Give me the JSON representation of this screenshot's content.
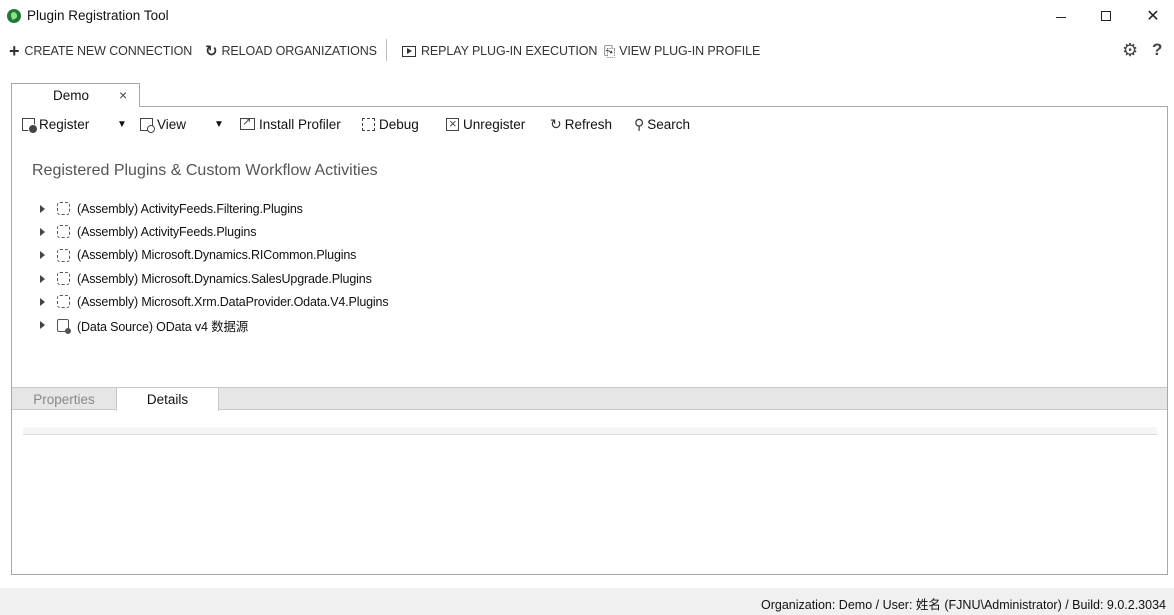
{
  "window": {
    "title": "Plugin Registration Tool",
    "minimize_icon": "minimize-icon",
    "maximize_icon": "maximize-icon",
    "close_glyph": "✕"
  },
  "main_toolbar": {
    "create_connection": "CREATE NEW CONNECTION",
    "reload_organizations": "RELOAD ORGANIZATIONS",
    "replay_execution": "REPLAY PLUG-IN EXECUTION",
    "view_profile": "VIEW PLUG-IN PROFILE",
    "settings_icon": "gear-icon",
    "help_label": "?"
  },
  "document_tab": {
    "label": "Demo",
    "close_glyph": "×"
  },
  "sub_toolbar": {
    "register": "Register",
    "view": "View",
    "install_profiler": "Install Profiler",
    "debug": "Debug",
    "unregister": "Unregister",
    "refresh": "Refresh",
    "search": "Search"
  },
  "section": {
    "title": "Registered Plugins & Custom Workflow Activities"
  },
  "tree": {
    "items": [
      {
        "label": "(Assembly) ActivityFeeds.Filtering.Plugins",
        "icon": "puzzle-icon"
      },
      {
        "label": "(Assembly) ActivityFeeds.Plugins",
        "icon": "puzzle-icon"
      },
      {
        "label": "(Assembly) Microsoft.Dynamics.RICommon.Plugins",
        "icon": "puzzle-icon"
      },
      {
        "label": "(Assembly) Microsoft.Dynamics.SalesUpgrade.Plugins",
        "icon": "puzzle-icon"
      },
      {
        "label": "(Assembly) Microsoft.Xrm.DataProvider.Odata.V4.Plugins",
        "icon": "puzzle-icon"
      },
      {
        "label": "(Data Source) OData v4 数据源",
        "icon": "data-source-icon"
      }
    ]
  },
  "bottom_tabs": {
    "properties": "Properties",
    "details": "Details",
    "active": "Details"
  },
  "status_bar": {
    "text": "Organization: Demo / User: 姓名 (FJNU\\Administrator) / Build: 9.0.2.3034"
  },
  "colors": {
    "logo": "#1f7a35",
    "panel_border": "#a8a8a8",
    "tabstrip": "#e6e6e6",
    "statusbar": "#f0f0f0"
  }
}
